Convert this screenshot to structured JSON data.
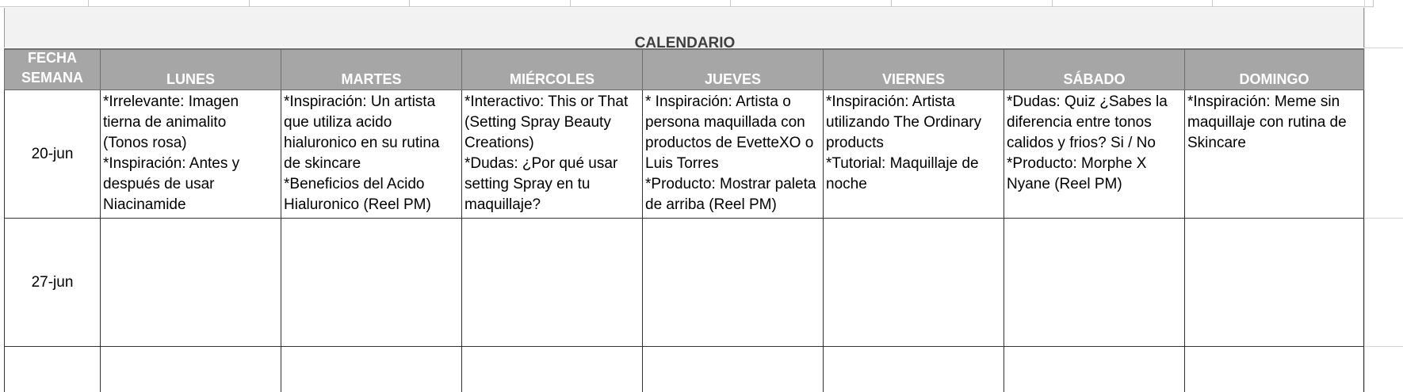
{
  "calendar": {
    "title": "CALENDARIO",
    "headers": [
      "FECHA\nSEMANA",
      "LUNES",
      "MARTES",
      "MIÉRCOLES",
      "JUEVES",
      "VIERNES",
      "SÁBADO",
      "DOMINGO"
    ],
    "rows": [
      {
        "date": "20-jun",
        "cells": [
          "*Irrelevante: Imagen\ntierna de animalito\n(Tonos rosa)\n*Inspiración: Antes y\ndespués de usar\nNiacinamide",
          "*Inspiración: Un artista\nque utiliza acido\nhialuronico en su rutina\nde skincare\n*Beneficios del Acido\nHialuronico (Reel PM)",
          "*Interactivo: This or That\n(Setting Spray Beauty\nCreations)\n*Dudas: ¿Por qué usar\nsetting Spray en tu\nmaquillaje?",
          "* Inspiración: Artista o\npersona maquillada con\nproductos de EvetteXO o\nLuis Torres\n*Producto: Mostrar paleta\nde arriba (Reel PM)",
          "*Inspiración: Artista\nutilizando The Ordinary\nproducts\n*Tutorial: Maquillaje de\nnoche",
          "*Dudas: Quiz ¿Sabes la\ndiferencia entre tonos\ncalidos y frios? Si / No\n*Producto: Morphe X\nNyane (Reel PM)",
          "*Inspiración: Meme sin\nmaquillaje con rutina de\nSkincare"
        ]
      },
      {
        "date": "27-jun",
        "cells": [
          "",
          "",
          "",
          "",
          "",
          "",
          ""
        ]
      },
      {
        "date": "",
        "cells": [
          "",
          "",
          "",
          "",
          "",
          "",
          ""
        ]
      }
    ]
  }
}
